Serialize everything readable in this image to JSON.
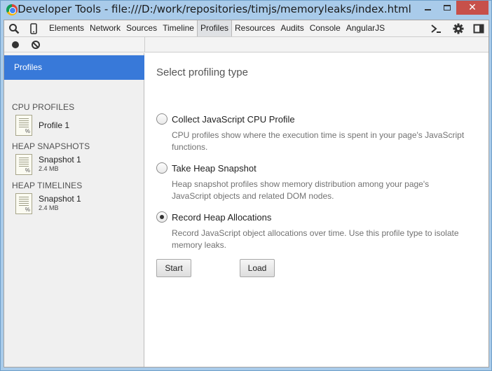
{
  "window": {
    "title": "Developer Tools - file:///D:/work/repositories/timjs/memoryleaks/index.html",
    "minimize_symbol": "",
    "close_symbol": "✕"
  },
  "tabs": [
    "Elements",
    "Network",
    "Sources",
    "Timeline",
    "Profiles",
    "Resources",
    "Audits",
    "Console",
    "AngularJS"
  ],
  "active_tab": "Profiles",
  "sidebar": {
    "header": "Profiles",
    "sections": [
      {
        "title": "CPU PROFILES",
        "items": [
          {
            "label": "Profile 1",
            "sub": ""
          }
        ]
      },
      {
        "title": "HEAP SNAPSHOTS",
        "items": [
          {
            "label": "Snapshot 1",
            "sub": "2.4 MB"
          }
        ]
      },
      {
        "title": "HEAP TIMELINES",
        "items": [
          {
            "label": "Snapshot 1",
            "sub": "2.4 MB"
          }
        ]
      }
    ],
    "file_icon_mark": "%"
  },
  "main": {
    "title": "Select profiling type",
    "options": [
      {
        "label": "Collect JavaScript CPU Profile",
        "desc": "CPU profiles show where the execution time is spent in your page's JavaScript functions.",
        "checked": false
      },
      {
        "label": "Take Heap Snapshot",
        "desc": "Heap snapshot profiles show memory distribution among your page's JavaScript objects and related DOM nodes.",
        "checked": false
      },
      {
        "label": "Record Heap Allocations",
        "desc": "Record JavaScript object allocations over time. Use this profile type to isolate memory leaks.",
        "checked": true
      }
    ],
    "start_label": "Start",
    "load_label": "Load"
  },
  "toolbar_icons": [
    "search-icon",
    "device-mode-icon",
    "console-drawer-icon",
    "gear-icon",
    "dock-side-icon"
  ],
  "colors": {
    "selected": "#3879d9",
    "close_button": "#c7504a"
  }
}
